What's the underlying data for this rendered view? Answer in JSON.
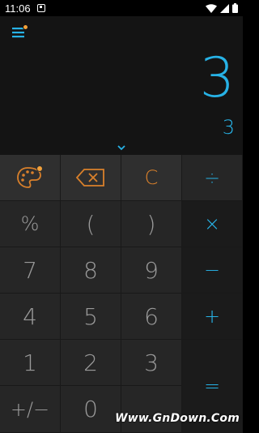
{
  "status": {
    "time": "11:06"
  },
  "display": {
    "result": "3",
    "expression": "3"
  },
  "keys": {
    "theme": "",
    "backspace": "",
    "clear": "C",
    "divide": "÷",
    "percent": "%",
    "paren_open": "(",
    "paren_close": ")",
    "multiply": "×",
    "d7": "7",
    "d8": "8",
    "d9": "9",
    "minus": "−",
    "d4": "4",
    "d5": "5",
    "d6": "6",
    "plus": "+",
    "d1": "1",
    "d2": "2",
    "d3": "3",
    "equals": "=",
    "negate": "+/−",
    "d0": "0"
  },
  "watermark": "Www.GnDown.Com",
  "colors": {
    "accent_blue": "#27b2e6",
    "accent_orange": "#d9802b"
  }
}
